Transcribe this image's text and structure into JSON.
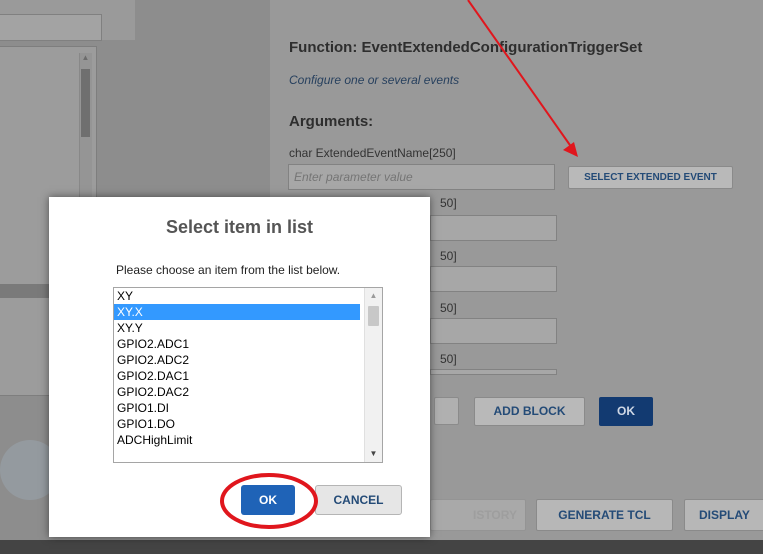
{
  "background": {
    "function_title": "Function: EventExtendedConfigurationTriggerSet",
    "function_desc": "Configure one or several events",
    "arguments_title": "Arguments:",
    "arg1_label": "char ExtendedEventName[250]",
    "arg1_placeholder": "Enter parameter value",
    "select_extended_event_label": "SELECT EXTENDED EVENT",
    "partial_labels": [
      "50]",
      "50]",
      "50]",
      "50]"
    ],
    "add_block_label": "ADD BLOCK",
    "ok_label": "OK",
    "history_label": "ISTORY",
    "generate_tcl_label": "GENERATE TCL",
    "display_label": "DISPLAY"
  },
  "dialog": {
    "title": "Select item in list",
    "message": "Please choose an item from the list below.",
    "items": [
      "XY",
      "XY.X",
      "XY.Y",
      "GPIO2.ADC1",
      "GPIO2.ADC2",
      "GPIO2.DAC1",
      "GPIO2.DAC2",
      "GPIO1.DI",
      "GPIO1.DO",
      "ADCHighLimit"
    ],
    "selected_index": 1,
    "ok_label": "OK",
    "cancel_label": "CANCEL"
  },
  "colors": {
    "accent": "#1f63b7",
    "selection": "#3399ff",
    "annotation": "#e0161d"
  },
  "icons": [
    "scroll-up-arrow-icon",
    "scroll-down-arrow-icon"
  ]
}
